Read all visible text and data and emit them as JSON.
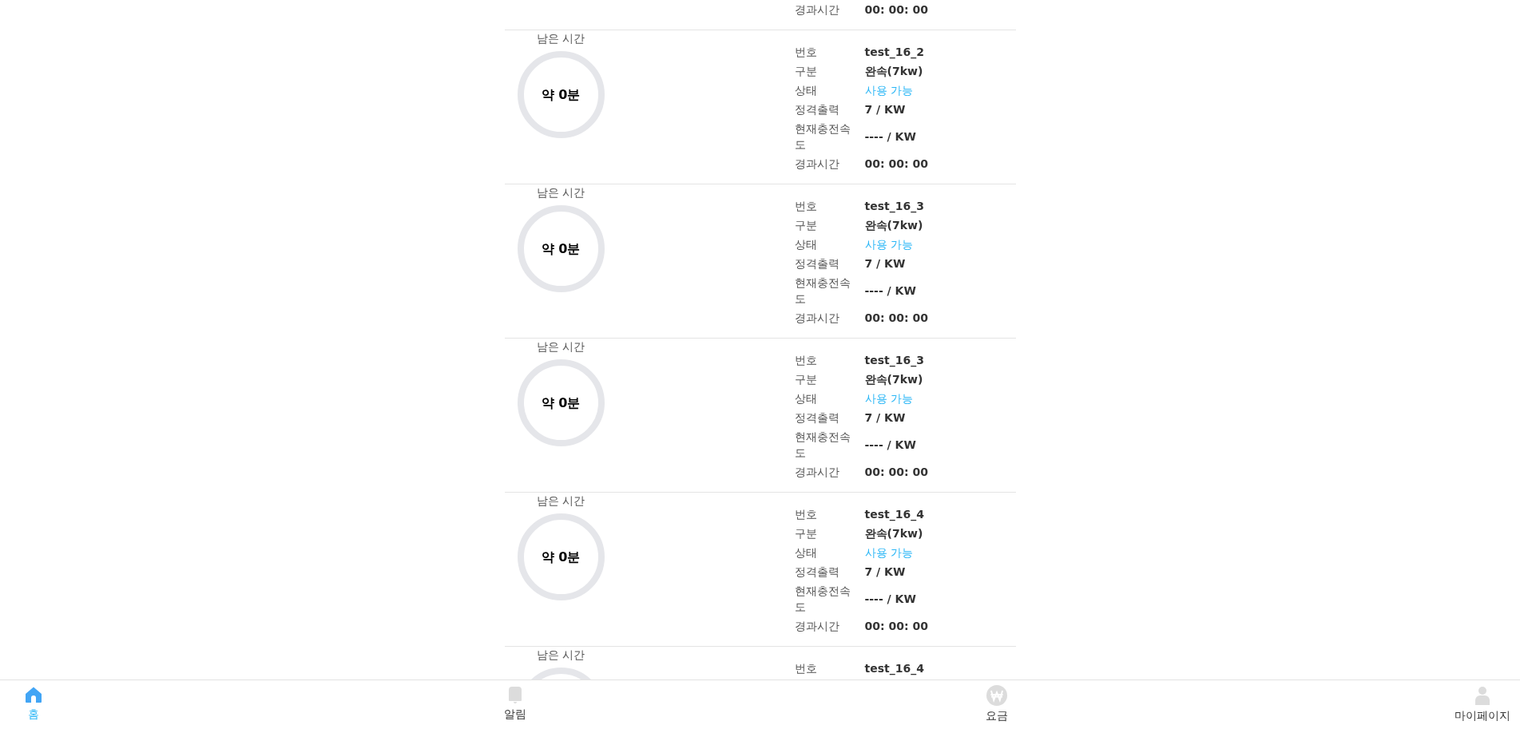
{
  "chargers": [
    {
      "rows": [
        {
          "label": "경과시간",
          "value": "00: 00: 00"
        }
      ]
    },
    {
      "remaining_label": "남은 시간",
      "remaining_value": "약 0분",
      "rows": [
        {
          "label": "번호",
          "value": "test_16_2"
        },
        {
          "label": "구분",
          "value": "완속(7kw)"
        },
        {
          "label": "상태",
          "value": "사용 가능",
          "kind": "status"
        },
        {
          "label": "정격출력",
          "value": "7 / KW"
        },
        {
          "label": "현재충전속도",
          "value": "---- / KW"
        },
        {
          "label": "경과시간",
          "value": "00: 00: 00"
        }
      ]
    },
    {
      "remaining_label": "남은 시간",
      "remaining_value": "약 0분",
      "rows": [
        {
          "label": "번호",
          "value": "test_16_3"
        },
        {
          "label": "구분",
          "value": "완속(7kw)"
        },
        {
          "label": "상태",
          "value": "사용 가능",
          "kind": "status"
        },
        {
          "label": "정격출력",
          "value": "7 / KW"
        },
        {
          "label": "현재충전속도",
          "value": "---- / KW"
        },
        {
          "label": "경과시간",
          "value": "00: 00: 00"
        }
      ]
    },
    {
      "remaining_label": "남은 시간",
      "remaining_value": "약 0분",
      "rows": [
        {
          "label": "번호",
          "value": "test_16_3"
        },
        {
          "label": "구분",
          "value": "완속(7kw)"
        },
        {
          "label": "상태",
          "value": "사용 가능",
          "kind": "status"
        },
        {
          "label": "정격출력",
          "value": "7 / KW"
        },
        {
          "label": "현재충전속도",
          "value": "---- / KW"
        },
        {
          "label": "경과시간",
          "value": "00: 00: 00"
        }
      ]
    },
    {
      "remaining_label": "남은 시간",
      "remaining_value": "약 0분",
      "rows": [
        {
          "label": "번호",
          "value": "test_16_4"
        },
        {
          "label": "구분",
          "value": "완속(7kw)"
        },
        {
          "label": "상태",
          "value": "사용 가능",
          "kind": "status"
        },
        {
          "label": "정격출력",
          "value": "7 / KW"
        },
        {
          "label": "현재충전속도",
          "value": "---- / KW"
        },
        {
          "label": "경과시간",
          "value": "00: 00: 00"
        }
      ]
    },
    {
      "remaining_label": "남은 시간",
      "rows": [
        {
          "label": "번호",
          "value": "test_16_4"
        }
      ]
    }
  ],
  "nav": [
    {
      "label": "홈",
      "kind": "home",
      "selected": true
    },
    {
      "label": "알림",
      "kind": "bell",
      "selected": false
    },
    {
      "label": "요금",
      "kind": "won",
      "selected": false
    },
    {
      "label": "마이페이지",
      "kind": "person",
      "selected": false
    }
  ]
}
